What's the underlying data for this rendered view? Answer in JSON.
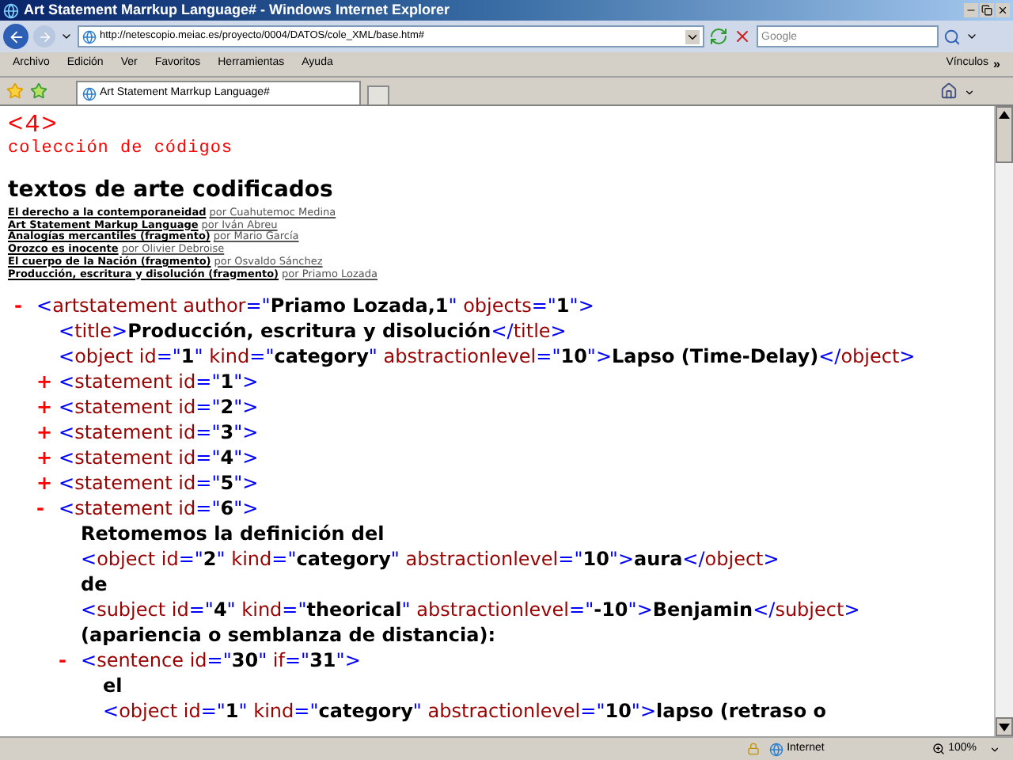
{
  "window": {
    "title": "Art Statement Marrkup Language# - Windows Internet Explorer"
  },
  "address_bar": {
    "url": "http://netescopio.meiac.es/proyecto/0004/DATOS/cole_XML/base.htm#"
  },
  "search": {
    "placeholder": "Google"
  },
  "menu": [
    "Archivo",
    "Edición",
    "Ver",
    "Favoritos",
    "Herramientas",
    "Ayuda"
  ],
  "links_bar": {
    "label": "Vínculos",
    "more": "»"
  },
  "tabs": [
    {
      "label": "Art Statement Marrkup Language#",
      "selected": true
    }
  ],
  "page": {
    "logo": {
      "mark": "<4>",
      "subtitle": "colección de códigos"
    },
    "heading": "textos de arte codificados",
    "texts": [
      {
        "title": "El derecho a la contemporaneidad",
        "author": "por Cuahutemoc Medina"
      },
      {
        "title": "Art Statement Markup Language",
        "author": "por Iván Abreu"
      },
      {
        "title": "Analogías mercantiles (fragmento)",
        "author": "por Mario García"
      },
      {
        "title": "Orozco es inocente",
        "author": "por Olivier Debroise"
      },
      {
        "title": "El cuerpo de la Nación (fragmento)",
        "author": "por Osvaldo Sánchez"
      },
      {
        "title": "Producción, escritura y disolución (fragmento)",
        "author": "por Priamo Lozada"
      }
    ]
  },
  "syntax": {
    "open": "<",
    "close": ">",
    "end_open": "</",
    "equals": "=",
    "quote": "\"",
    "collapse": "-",
    "expand": "+"
  },
  "xml": {
    "kind": "element",
    "tag": "artstatement",
    "attributes": [
      {
        "name": "author",
        "value": "Priamo Lozada,1"
      },
      {
        "name": "objects",
        "value": "1"
      }
    ],
    "expanded": true,
    "children": [
      {
        "kind": "inline",
        "tag": "title",
        "text": "Producción, escritura y disolución",
        "close_tag": "title"
      },
      {
        "kind": "inline",
        "tag": "object",
        "attributes": [
          {
            "name": "id",
            "value": "1"
          },
          {
            "name": "kind",
            "value": "category"
          },
          {
            "name": "abstractionlevel",
            "value": "10"
          }
        ],
        "text": "Lapso (Time-Delay)",
        "close_tag": "object"
      },
      {
        "kind": "element",
        "tag": "statement",
        "attributes": [
          {
            "name": "id",
            "value": "1"
          }
        ],
        "expanded": false
      },
      {
        "kind": "element",
        "tag": "statement",
        "attributes": [
          {
            "name": "id",
            "value": "2"
          }
        ],
        "expanded": false
      },
      {
        "kind": "element",
        "tag": "statement",
        "attributes": [
          {
            "name": "id",
            "value": "3"
          }
        ],
        "expanded": false
      },
      {
        "kind": "element",
        "tag": "statement",
        "attributes": [
          {
            "name": "id",
            "value": "4"
          }
        ],
        "expanded": false
      },
      {
        "kind": "element",
        "tag": "statement",
        "attributes": [
          {
            "name": "id",
            "value": "5"
          }
        ],
        "expanded": false
      },
      {
        "kind": "element",
        "tag": "statement",
        "attributes": [
          {
            "name": "id",
            "value": "6"
          }
        ],
        "expanded": true,
        "children": [
          {
            "kind": "text",
            "text": "Retomemos la definición del"
          },
          {
            "kind": "inline",
            "tag": "object",
            "attributes": [
              {
                "name": "id",
                "value": "2"
              },
              {
                "name": "kind",
                "value": "category"
              },
              {
                "name": "abstractionlevel",
                "value": "10"
              }
            ],
            "text": "aura",
            "close_tag": "object"
          },
          {
            "kind": "text",
            "text": "de"
          },
          {
            "kind": "inline",
            "tag": "subject",
            "attributes": [
              {
                "name": "id",
                "value": "4"
              },
              {
                "name": "kind",
                "value": "theorical"
              },
              {
                "name": "abstractionlevel",
                "value": "-10"
              }
            ],
            "text": "Benjamin",
            "close_tag": "subject"
          },
          {
            "kind": "text",
            "text": "(apariencia o semblanza de distancia):"
          },
          {
            "kind": "element",
            "tag": "sentence",
            "attributes": [
              {
                "name": "id",
                "value": "30"
              },
              {
                "name": "if",
                "value": "31"
              }
            ],
            "expanded": true,
            "children": [
              {
                "kind": "text",
                "text": "el"
              },
              {
                "kind": "open_text",
                "tag": "object",
                "attributes": [
                  {
                    "name": "id",
                    "value": "1"
                  },
                  {
                    "name": "kind",
                    "value": "category"
                  },
                  {
                    "name": "abstractionlevel",
                    "value": "10"
                  }
                ],
                "text": "lapso (retraso o"
              }
            ]
          }
        ]
      }
    ]
  },
  "status_bar": {
    "zone": "Internet",
    "zoom": "100%"
  }
}
